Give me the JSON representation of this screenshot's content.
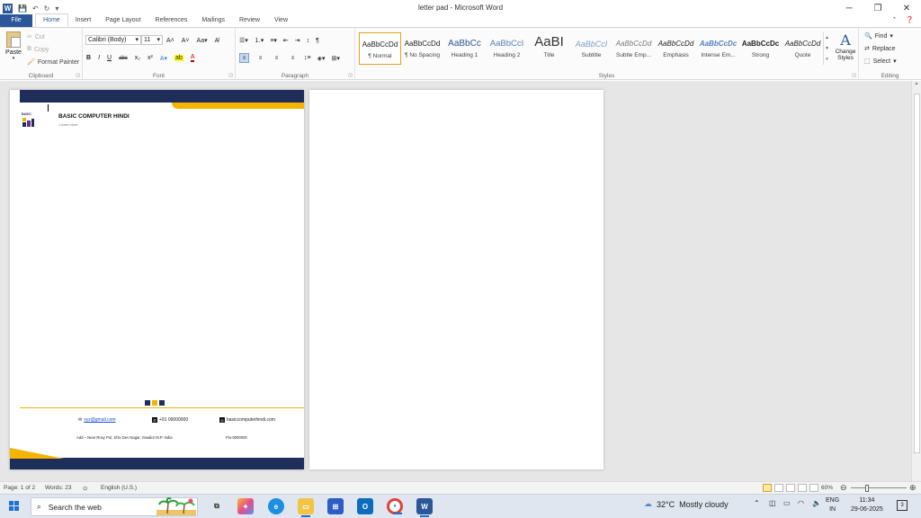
{
  "window": {
    "title": "letter pad - Microsoft Word",
    "app_logo": "W",
    "controls": [
      "minimize-icon",
      "restore-icon",
      "close-icon"
    ]
  },
  "tabs": [
    "File",
    "Home",
    "Insert",
    "Page Layout",
    "References",
    "Mailings",
    "Review",
    "View"
  ],
  "active_tab": "Home",
  "ribbon": {
    "clipboard": {
      "paste": "Paste",
      "cut": "Cut",
      "copy": "Copy",
      "format_painter": "Format Painter",
      "label": "Clipboard"
    },
    "font": {
      "font_name": "Calibri (Body)",
      "font_size": "11",
      "label": "Font",
      "buttons_row2": [
        "B",
        "I",
        "U",
        "abc",
        "x₂",
        "x²"
      ]
    },
    "paragraph": {
      "label": "Paragraph",
      "pilcrow": "¶"
    },
    "styles": {
      "label": "Styles",
      "items": [
        {
          "sample": "AaBbCcDd",
          "name": "¶ Normal"
        },
        {
          "sample": "AaBbCcDd",
          "name": "¶ No Spacing"
        },
        {
          "sample": "AaBbCc",
          "name": "Heading 1"
        },
        {
          "sample": "AaBbCcI",
          "name": "Heading 2"
        },
        {
          "sample": "AaBI",
          "name": "Title"
        },
        {
          "sample": "AaBbCcI",
          "name": "Subtitle"
        },
        {
          "sample": "AaBbCcDd",
          "name": "Subtle Emp..."
        },
        {
          "sample": "AaBbCcDd",
          "name": "Emphasis"
        },
        {
          "sample": "AaBbCcDc",
          "name": "Intense Em..."
        },
        {
          "sample": "AaBbCcDc",
          "name": "Strong"
        },
        {
          "sample": "AaBbCcDd",
          "name": "Quote"
        }
      ],
      "change_styles": "Change Styles"
    },
    "editing": {
      "label": "Editing",
      "find": "Find",
      "replace": "Replace",
      "select": "Select"
    }
  },
  "letterpad": {
    "logo_text": "BASIC",
    "brand": "BASIC COMPUTER HINDI",
    "tagline": "Learn more",
    "email": "xyz@gmail.com",
    "phone": "+91 00000000",
    "website": "basiccomputerhindi.com",
    "address": "Add – Near Roxy Pul, Shiv Dev Nagar, Gwalior M.P. India",
    "pin": "Pin-0000000",
    "colors": {
      "navy": "#1f2d5a",
      "yellow": "#f5b400"
    }
  },
  "statusbar": {
    "page": "Page: 1 of 2",
    "words": "Words: 23",
    "language": "English (U.S.)",
    "zoom": "60%"
  },
  "taskbar": {
    "search_placeholder": "Search the web",
    "weather_temp": "32°C",
    "weather_desc": "Mostly cloudy",
    "lang_top": "ENG",
    "lang_bottom": "IN",
    "time": "11:34",
    "date": "29-06-2025",
    "notification_count": "3"
  }
}
